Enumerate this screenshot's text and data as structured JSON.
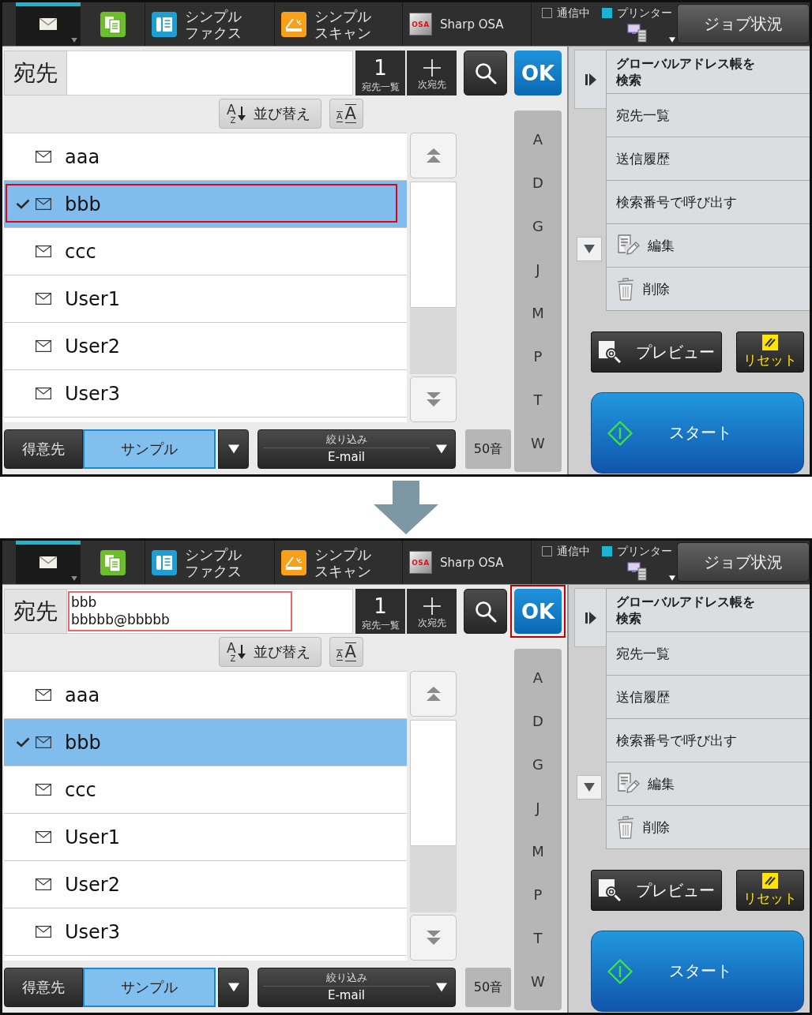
{
  "screens": [
    {
      "header": {
        "tabs": [
          {
            "kind": "mail",
            "selected": true
          },
          {
            "kind": "copy",
            "selected": false
          },
          {
            "kind": "fax",
            "label": [
              "シンプル",
              "ファクス"
            ],
            "selected": false
          },
          {
            "kind": "scan",
            "label": [
              "シンプル",
              "スキャン"
            ],
            "selected": false
          },
          {
            "kind": "osa",
            "logo_text": "OSA",
            "label": [
              "Sharp OSA"
            ],
            "selected": false
          }
        ],
        "status": [
          {
            "label": "通信中",
            "on": false
          },
          {
            "label": "プリンター",
            "on": true
          }
        ],
        "job_status_button": "ジョブ状況"
      },
      "destination": {
        "label": "宛先",
        "highlighted": false
      },
      "count_button": {
        "count": "1",
        "label": "宛先一覧"
      },
      "next_button": {
        "label": "次宛先"
      },
      "ok_button": {
        "label": "OK",
        "highlighted": false
      },
      "sort_button": {
        "letters": [
          "A",
          "Z"
        ],
        "label": "並び替え"
      },
      "font_size_button": {
        "letters": [
          "A",
          "A"
        ]
      },
      "rows": [
        {
          "name": "aaa",
          "selected": false,
          "highlighted": false
        },
        {
          "name": "bbb",
          "selected": true,
          "highlighted": true
        },
        {
          "name": "ccc",
          "selected": false,
          "highlighted": false
        },
        {
          "name": "User1",
          "selected": false,
          "highlighted": false
        },
        {
          "name": "User2",
          "selected": false,
          "highlighted": false
        },
        {
          "name": "User3",
          "selected": false,
          "highlighted": false
        }
      ],
      "index_letters": [
        "A",
        "D",
        "G",
        "J",
        "M",
        "P",
        "T",
        "W"
      ],
      "groups": [
        {
          "label": "得意先",
          "selected": false
        },
        {
          "label": "サンプル",
          "selected": true
        }
      ],
      "filter": {
        "label": "絞り込み",
        "value": "E-mail"
      },
      "kana_button": "50音",
      "menu": [
        {
          "kind": "title",
          "lines": [
            "グローバルアドレス帳を",
            "検索"
          ]
        },
        {
          "kind": "plain",
          "lines": [
            "宛先一覧"
          ]
        },
        {
          "kind": "plain",
          "lines": [
            "送信履歴"
          ]
        },
        {
          "kind": "plain",
          "lines": [
            "検索番号で呼び出す"
          ]
        },
        {
          "kind": "edit",
          "lines": [
            "編集"
          ]
        },
        {
          "kind": "delete",
          "lines": [
            "削除"
          ]
        }
      ],
      "preview_button": "プレビュー",
      "reset_button": "リセット",
      "start_button": "スタート"
    },
    {
      "header": {
        "tabs": [
          {
            "kind": "mail",
            "selected": true
          },
          {
            "kind": "copy",
            "selected": false
          },
          {
            "kind": "fax",
            "label": [
              "シンプル",
              "ファクス"
            ],
            "selected": false
          },
          {
            "kind": "scan",
            "label": [
              "シンプル",
              "スキャン"
            ],
            "selected": false
          },
          {
            "kind": "osa",
            "logo_text": "OSA",
            "label": [
              "Sharp OSA"
            ],
            "selected": false
          }
        ],
        "status": [
          {
            "label": "通信中",
            "on": false
          },
          {
            "label": "プリンター",
            "on": true
          }
        ],
        "job_status_button": "ジョブ状況"
      },
      "destination": {
        "label": "宛先",
        "value_lines": [
          "bbb",
          "bbbbb@bbbbb"
        ],
        "highlighted": true
      },
      "count_button": {
        "count": "1",
        "label": "宛先一覧"
      },
      "next_button": {
        "label": "次宛先"
      },
      "ok_button": {
        "label": "OK",
        "highlighted": true
      },
      "sort_button": {
        "letters": [
          "A",
          "Z"
        ],
        "label": "並び替え"
      },
      "font_size_button": {
        "letters": [
          "A",
          "A"
        ]
      },
      "rows": [
        {
          "name": "aaa",
          "selected": false,
          "highlighted": false
        },
        {
          "name": "bbb",
          "selected": true,
          "highlighted": false
        },
        {
          "name": "ccc",
          "selected": false,
          "highlighted": false
        },
        {
          "name": "User1",
          "selected": false,
          "highlighted": false
        },
        {
          "name": "User2",
          "selected": false,
          "highlighted": false
        },
        {
          "name": "User3",
          "selected": false,
          "highlighted": false
        }
      ],
      "index_letters": [
        "A",
        "D",
        "G",
        "J",
        "M",
        "P",
        "T",
        "W"
      ],
      "groups": [
        {
          "label": "得意先",
          "selected": false
        },
        {
          "label": "サンプル",
          "selected": true
        }
      ],
      "filter": {
        "label": "絞り込み",
        "value": "E-mail"
      },
      "kana_button": "50音",
      "menu": [
        {
          "kind": "title",
          "lines": [
            "グローバルアドレス帳を",
            "検索"
          ]
        },
        {
          "kind": "plain",
          "lines": [
            "宛先一覧"
          ]
        },
        {
          "kind": "plain",
          "lines": [
            "送信履歴"
          ]
        },
        {
          "kind": "plain",
          "lines": [
            "検索番号で呼び出す"
          ]
        },
        {
          "kind": "edit",
          "lines": [
            "編集"
          ]
        },
        {
          "kind": "delete",
          "lines": [
            "削除"
          ]
        }
      ],
      "preview_button": "プレビュー",
      "reset_button": "リセット",
      "start_button": "スタート"
    }
  ]
}
